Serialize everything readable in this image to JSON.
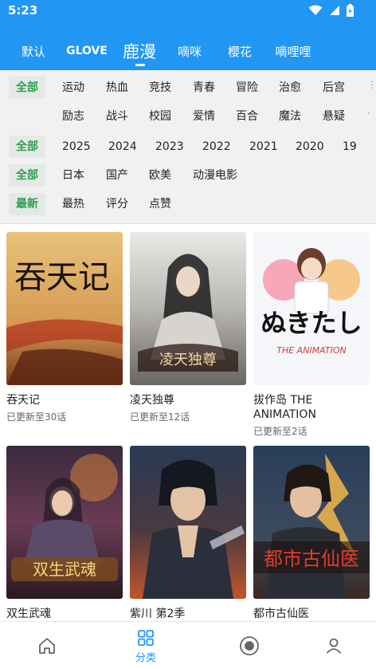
{
  "status": {
    "time": "5:23"
  },
  "tabs": [
    {
      "label": "默认"
    },
    {
      "label": "GLOVE"
    },
    {
      "label": "鹿漫"
    },
    {
      "label": "嘀咪"
    },
    {
      "label": "樱花"
    },
    {
      "label": "嘀哩哩"
    }
  ],
  "active_tab": "鹿漫",
  "filters": {
    "genre_all": "全部",
    "genres_row1": [
      "运动",
      "热血",
      "竞技",
      "青春",
      "冒险",
      "治愈",
      "后宫"
    ],
    "genres_row2": [
      "励志",
      "战斗",
      "校园",
      "爱情",
      "百合",
      "魔法",
      "悬疑"
    ],
    "year_all": "全部",
    "years": [
      "2025",
      "2024",
      "2023",
      "2022",
      "2021",
      "2020",
      "19"
    ],
    "region_all": "全部",
    "regions": [
      "日本",
      "国产",
      "欧美",
      "动漫电影"
    ],
    "sort_selected": "最新",
    "sorts": [
      "最热",
      "评分",
      "点赞"
    ]
  },
  "cards": [
    {
      "title": "吞天记",
      "subtitle": "已更新至30话",
      "poster_text": "吞天记"
    },
    {
      "title": "凌天独尊",
      "subtitle": "已更新至12话",
      "poster_text": "凌天独尊"
    },
    {
      "title": "拔作岛 THE ANIMATION",
      "subtitle": "已更新至2话",
      "poster_text": "ぬきたし",
      "poster_sub": "THE ANIMATION"
    },
    {
      "title": "双生武魂",
      "subtitle": "",
      "poster_text": "双生武魂"
    },
    {
      "title": "紫川 第2季",
      "subtitle": "",
      "poster_text": ""
    },
    {
      "title": "都市古仙医",
      "subtitle": "",
      "poster_text": "都市古仙医"
    }
  ],
  "bottom_nav": [
    {
      "icon": "home-icon",
      "label": ""
    },
    {
      "icon": "grid-icon",
      "label": "分类"
    },
    {
      "icon": "eye-icon",
      "label": ""
    },
    {
      "icon": "user-icon",
      "label": ""
    }
  ],
  "colors": {
    "primary": "#2196F3",
    "selected_green": "#2e9e4f",
    "filter_bg": "#f1f1f1"
  }
}
